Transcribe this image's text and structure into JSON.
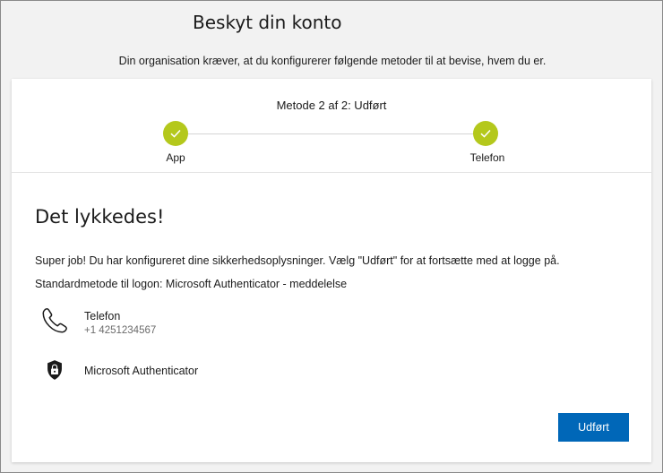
{
  "page": {
    "title": "Beskyt din konto",
    "subtitle": "Din organisation kræver, at du konfigurerer følgende metoder til at bevise, hvem du er."
  },
  "progress": {
    "status": "Metode 2 af 2: Udført",
    "steps": [
      {
        "label": "App",
        "state": "completed",
        "icon": "checkmark-icon"
      },
      {
        "label": "Telefon",
        "state": "completed",
        "icon": "checkmark-icon"
      }
    ],
    "accent_color": "#b4c81c"
  },
  "content": {
    "heading": "Det lykkedes!",
    "message": "Super job! Du har konfigureret dine sikkerhedsoplysninger. Vælg \"Udført\" for at fortsætte med at logge på.",
    "default_method": "Standardmetode til logon: Microsoft Authenticator - meddelelse",
    "methods": [
      {
        "name": "Telefon",
        "detail": "+1 4251234567",
        "icon": "phone-icon"
      },
      {
        "name": "Microsoft Authenticator",
        "icon": "authenticator-lock-icon"
      }
    ]
  },
  "actions": {
    "done_label": "Udført",
    "button_color": "#0067b8"
  }
}
